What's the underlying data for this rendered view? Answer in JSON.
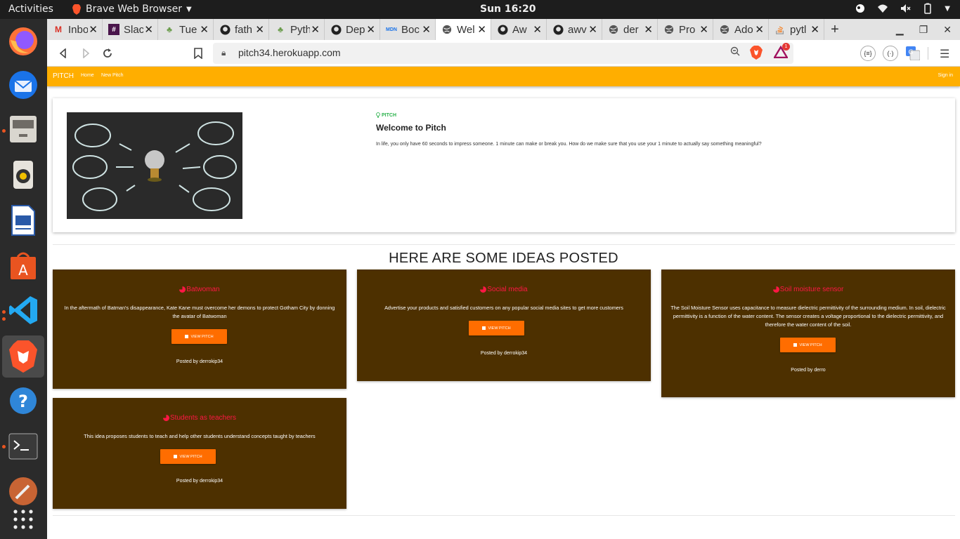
{
  "system": {
    "activities": "Activities",
    "app_name": "Brave Web Browser",
    "clock": "Sun 16:20"
  },
  "browser": {
    "tabs": [
      {
        "label": "Inbo",
        "icon": "gmail-icon"
      },
      {
        "label": "Slac",
        "icon": "slack-icon"
      },
      {
        "label": "Tue",
        "icon": "tree-icon"
      },
      {
        "label": "fath",
        "icon": "github-icon"
      },
      {
        "label": "Pyth",
        "icon": "tree-icon"
      },
      {
        "label": "Dep",
        "icon": "github-icon"
      },
      {
        "label": "Boc",
        "icon": "mdn-icon"
      },
      {
        "label": "Wel",
        "icon": "globe-icon",
        "active": true
      },
      {
        "label": "Aw",
        "icon": "github-icon"
      },
      {
        "label": "awv",
        "icon": "github-icon"
      },
      {
        "label": "der",
        "icon": "globe-icon"
      },
      {
        "label": "Pro",
        "icon": "globe-icon"
      },
      {
        "label": "Ado",
        "icon": "globe-icon"
      },
      {
        "label": "pytl",
        "icon": "stackoverflow-icon"
      }
    ],
    "url": "pitch34.herokuapp.com",
    "rewards_badge": "1",
    "ext1": "{≡}",
    "ext2": "(·)"
  },
  "site": {
    "brand": "PITCH",
    "nav": {
      "home": "Home",
      "new_pitch": "New Pitch",
      "sign_in": "Sign in"
    },
    "hero": {
      "kicker": "PITCH",
      "title": "Welcome to Pitch",
      "description": "In life, you only have 60 seconds to impress someone. 1 minute can make or break you. How do we make sure that you use your 1 minute to actually say something meaningful?"
    },
    "section_title": "HERE ARE SOME IDEAS POSTED",
    "button_label": "VIEW PITCH",
    "pitches": [
      {
        "title": "Batwoman",
        "description": "In the aftermath of Batman's disappearance, Kate Kane must overcome her demons to protect Gotham City by donning the avatar of Batwoman",
        "posted_by": "Posted by derrokip34"
      },
      {
        "title": "Social media",
        "description": "Advertise your products and satisfied customers on any popular social media sites to get more customers",
        "posted_by": "Posted by derrokip34"
      },
      {
        "title": "Soil moisture sensor",
        "description": "The Soil Moisture Sensor uses capacitance to measure dielectric permittivity of the surrounding medium. In soil, dielectric permittivity is a function of the water content. The sensor creates a voltage proportional to the dielectric permittivity, and therefore the water content of the soil.",
        "posted_by": "Posted by derro"
      },
      {
        "title": "Students as teachers",
        "description": "This idea proposes students to teach and help other students understand concepts taught by teachers",
        "posted_by": "Posted by derrokip34"
      }
    ]
  },
  "colors": {
    "navbar": "#ffae00",
    "card_bg": "#4d3000",
    "card_title": "#ff1744",
    "button": "#ff6d00"
  }
}
